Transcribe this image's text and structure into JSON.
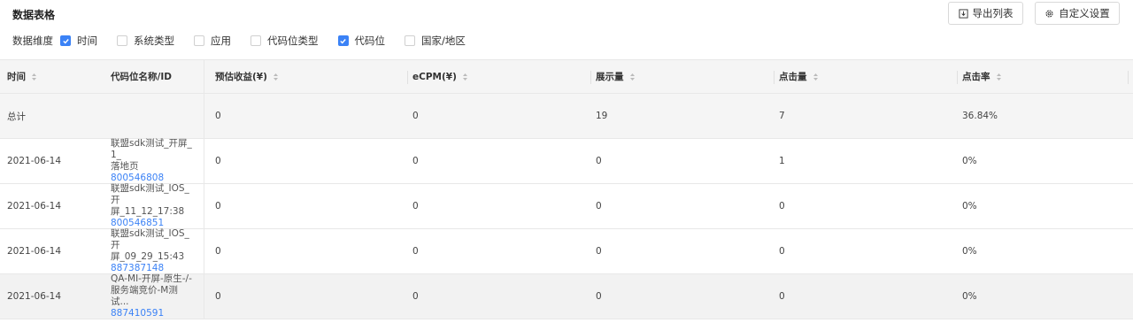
{
  "section_title": "数据表格",
  "toolbar": {
    "export_label": "导出列表",
    "settings_label": "自定义设置"
  },
  "dimensions": {
    "label": "数据维度",
    "options": [
      {
        "label": "时间",
        "checked": true
      },
      {
        "label": "系统类型",
        "checked": false
      },
      {
        "label": "应用",
        "checked": false
      },
      {
        "label": "代码位类型",
        "checked": false
      },
      {
        "label": "代码位",
        "checked": true
      },
      {
        "label": "国家/地区",
        "checked": false
      }
    ]
  },
  "table": {
    "columns": [
      "时间",
      "代码位名称/ID",
      "预估收益(¥)",
      "eCPM(¥)",
      "展示量",
      "点击量",
      "点击率"
    ],
    "total": {
      "label": "总计",
      "revenue": "0",
      "ecpm": "0",
      "impressions": "19",
      "clicks": "7",
      "ctr": "36.84%"
    },
    "rows": [
      {
        "date": "2021-06-14",
        "name_line1": "联盟sdk测试_开屏_1_",
        "name_line2": "落地页",
        "id": "800546808",
        "revenue": "0",
        "ecpm": "0",
        "impressions": "0",
        "clicks": "1",
        "ctr": "0%"
      },
      {
        "date": "2021-06-14",
        "name_line1": "联盟sdk测试_IOS_开",
        "name_line2": "屏_11_12_17:38",
        "id": "800546851",
        "revenue": "0",
        "ecpm": "0",
        "impressions": "0",
        "clicks": "0",
        "ctr": "0%"
      },
      {
        "date": "2021-06-14",
        "name_line1": "联盟sdk测试_IOS_开",
        "name_line2": "屏_09_29_15:43",
        "id": "887387148",
        "revenue": "0",
        "ecpm": "0",
        "impressions": "0",
        "clicks": "0",
        "ctr": "0%"
      },
      {
        "date": "2021-06-14",
        "name_line1": "QA-MI-开屏-原生-/-",
        "name_line2": "服务端竞价-M测试...",
        "id": "887410591",
        "revenue": "0",
        "ecpm": "0",
        "impressions": "0",
        "clicks": "0",
        "ctr": "0%"
      }
    ]
  },
  "colors": {
    "accent": "#3b82f6",
    "header_bg": "#f5f5f5",
    "border": "#e8e8e8"
  }
}
